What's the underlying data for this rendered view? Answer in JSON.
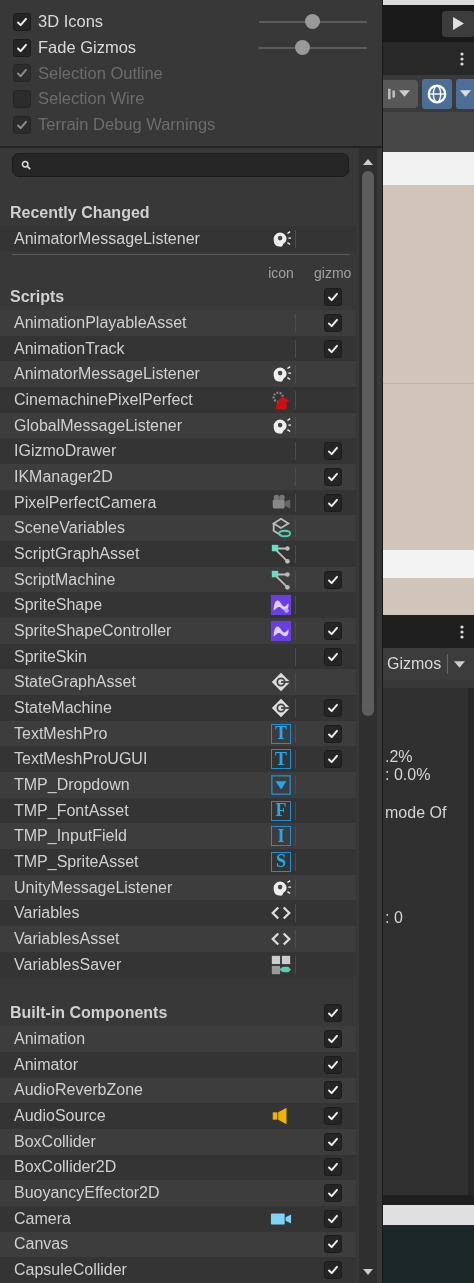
{
  "options": [
    {
      "label": "3D Icons",
      "checked": true,
      "disabled": false,
      "level": 0.49
    },
    {
      "label": "Fade Gizmos",
      "checked": true,
      "disabled": false,
      "level": 0.39
    },
    {
      "label": "Selection Outline",
      "checked": true,
      "disabled": true
    },
    {
      "label": "Selection Wire",
      "checked": false,
      "disabled": true
    },
    {
      "label": "Terrain Debug Warnings",
      "checked": true,
      "disabled": true
    }
  ],
  "recently_changed": {
    "title": "Recently Changed",
    "items": [
      {
        "name": "AnimatorMessageListener",
        "kind": "ear"
      }
    ]
  },
  "column_headers": [
    "icon",
    "gizmo"
  ],
  "sections": [
    {
      "title": "Scripts",
      "kind": "scripts",
      "gizmo_checked": true,
      "rows": [
        {
          "name": "AnimationPlayableAsset",
          "kind": "none",
          "gizmo_checked": true
        },
        {
          "name": "AnimationTrack",
          "kind": "none",
          "gizmo_checked": true
        },
        {
          "name": "AnimatorMessageListener",
          "kind": "ear",
          "gizmo_checked": false
        },
        {
          "name": "CinemachinePixelPerfect",
          "kind": "cinemachine",
          "gizmo_checked": false
        },
        {
          "name": "GlobalMessageListener",
          "kind": "ear",
          "gizmo_checked": false
        },
        {
          "name": "IGizmoDrawer",
          "kind": "none",
          "gizmo_checked": true
        },
        {
          "name": "IKManager2D",
          "kind": "none",
          "gizmo_checked": true
        },
        {
          "name": "PixelPerfectCamera",
          "kind": "pixelcamera",
          "gizmo_checked": true
        },
        {
          "name": "SceneVariables",
          "kind": "scenevariables",
          "gizmo_checked": false
        },
        {
          "name": "ScriptGraphAsset",
          "kind": "graph",
          "gizmo_checked": false
        },
        {
          "name": "ScriptMachine",
          "kind": "graph",
          "gizmo_checked": true
        },
        {
          "name": "SpriteShape",
          "kind": "spriteshape",
          "gizmo_checked": false
        },
        {
          "name": "SpriteShapeController",
          "kind": "spritecontroller",
          "gizmo_checked": true
        },
        {
          "name": "SpriteSkin",
          "kind": "none",
          "gizmo_checked": true
        },
        {
          "name": "StateGraphAsset",
          "kind": "state",
          "gizmo_checked": false
        },
        {
          "name": "StateMachine",
          "kind": "state",
          "gizmo_checked": true
        },
        {
          "name": "TextMeshPro",
          "kind": "tmp",
          "icon_letter": "T",
          "gizmo_checked": true
        },
        {
          "name": "TextMeshProUGUI",
          "kind": "tmp",
          "icon_letter": "T",
          "gizmo_checked": true
        },
        {
          "name": "TMP_Dropdown",
          "kind": "dropdown",
          "gizmo_checked": false
        },
        {
          "name": "TMP_FontAsset",
          "kind": "tmp",
          "icon_letter": "F",
          "gizmo_checked": false
        },
        {
          "name": "TMP_InputField",
          "kind": "tmp",
          "icon_letter": "I",
          "gizmo_checked": false
        },
        {
          "name": "TMP_SpriteAsset",
          "kind": "tmp",
          "icon_letter": "S",
          "gizmo_checked": false
        },
        {
          "name": "UnityMessageListener",
          "kind": "ear",
          "gizmo_checked": false
        },
        {
          "name": "Variables",
          "kind": "variables",
          "gizmo_checked": false
        },
        {
          "name": "VariablesAsset",
          "kind": "variables",
          "gizmo_checked": false
        },
        {
          "name": "VariablesSaver",
          "kind": "saver",
          "gizmo_checked": false
        }
      ]
    },
    {
      "title": "Built-in Components",
      "kind": "builtin",
      "gizmo_checked": true,
      "rows": [
        {
          "name": "Animation",
          "kind": "none",
          "gizmo_checked": true
        },
        {
          "name": "Animator",
          "kind": "none",
          "gizmo_checked": true
        },
        {
          "name": "AudioReverbZone",
          "kind": "none",
          "gizmo_checked": true
        },
        {
          "name": "AudioSource",
          "kind": "audio",
          "gizmo_checked": true
        },
        {
          "name": "BoxCollider",
          "kind": "none",
          "gizmo_checked": true
        },
        {
          "name": "BoxCollider2D",
          "kind": "none",
          "gizmo_checked": true
        },
        {
          "name": "BuoyancyEffector2D",
          "kind": "none",
          "gizmo_checked": true
        },
        {
          "name": "Camera",
          "kind": "camera",
          "gizmo_checked": true
        },
        {
          "name": "Canvas",
          "kind": "none",
          "gizmo_checked": true
        },
        {
          "name": "CapsuleCollider",
          "kind": "none",
          "gizmo_checked": true
        }
      ]
    }
  ],
  "scene_view": {
    "tab_label": "Gizmos",
    "stats": [
      ".2%",
      ": 0.0%",
      "mode Of",
      ": 0"
    ]
  }
}
